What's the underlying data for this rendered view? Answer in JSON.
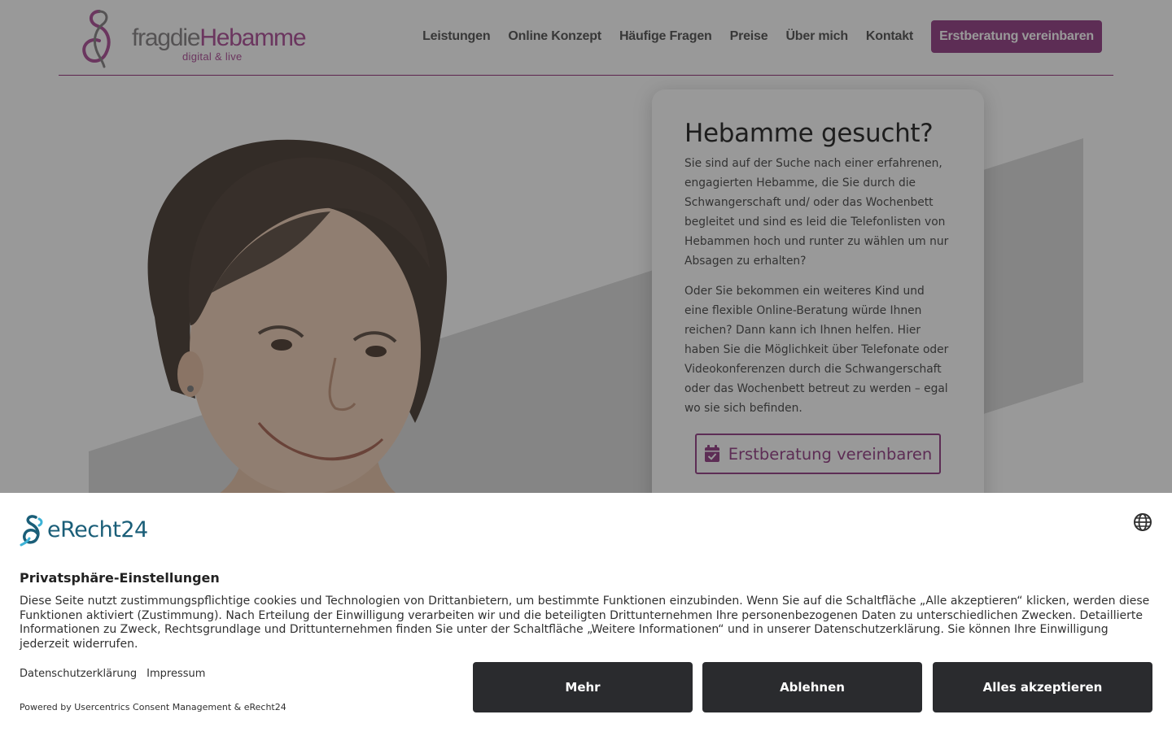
{
  "site": {
    "logo": {
      "word_part1": "fragdie",
      "word_part2": "Hebamme",
      "tagline": "digital & live"
    },
    "nav": {
      "items": [
        "Leistungen",
        "Online Konzept",
        "Häufige Fragen",
        "Preise",
        "Über mich",
        "Kontakt"
      ],
      "cta": "Erstberatung vereinbaren"
    },
    "card": {
      "title": "Hebamme gesucht?",
      "paragraph1": "Sie sind auf der Suche nach einer erfahrenen, engagierten Hebamme, die Sie durch die Schwangerschaft und/ oder das Wochenbett begleitet und sind es leid die Telefonlisten von Hebammen hoch und runter zu wählen um nur Absagen zu erhalten?",
      "paragraph2": "Oder Sie bekommen ein weiteres Kind und eine flexible Online-Beratung würde Ihnen reichen? Dann kann ich Ihnen helfen. Hier haben Sie die Möglichkeit über Telefonate oder Videokonferenzen durch die Schwangerschaft oder das Wochenbett betreut zu werden – egal wo sie sich befinden.",
      "button": "Erstberatung vereinbaren"
    }
  },
  "consent": {
    "brand": "eRecht24",
    "title": "Privatsphäre-Einstellungen",
    "text": "Diese Seite nutzt zustimmungspflichtige cookies und Technologien von Drittanbietern, um bestimmte Funktionen einzubinden. Wenn Sie auf die Schaltfläche „Alle akzeptieren“ klicken, werden diese Funktionen aktiviert (Zustimmung). Nach Erteilung der Einwilligung verarbeiten wir und die beteiligten Drittunternehmen Ihre personenbezogenen Daten zu unterschiedlichen Zwecken. Detaillierte Informationen zu Zweck, Rechtsgrundlage und Drittunternehmen finden Sie unter der Schaltfläche „Weitere Informationen“ und in unserer Datenschutzerklärung. Sie können Ihre Einwilligung jederzeit widerrufen.",
    "links": [
      "Datenschutzerklärung",
      "Impressum"
    ],
    "powered_by": "Powered by Usercentrics Consent Management & eRecht24",
    "buttons": {
      "more": "Mehr",
      "deny": "Ablehnen",
      "accept_all": "Alles akzeptieren"
    }
  },
  "colors": {
    "brand_purple": "#9b4b8e",
    "consent_button": "#2a2b2e",
    "erecht_blue": "#1a5e78"
  },
  "icons": [
    "logo-mark-icon",
    "portrait-image",
    "calendar-check-icon",
    "erecht24-logo-icon",
    "globe-icon"
  ]
}
